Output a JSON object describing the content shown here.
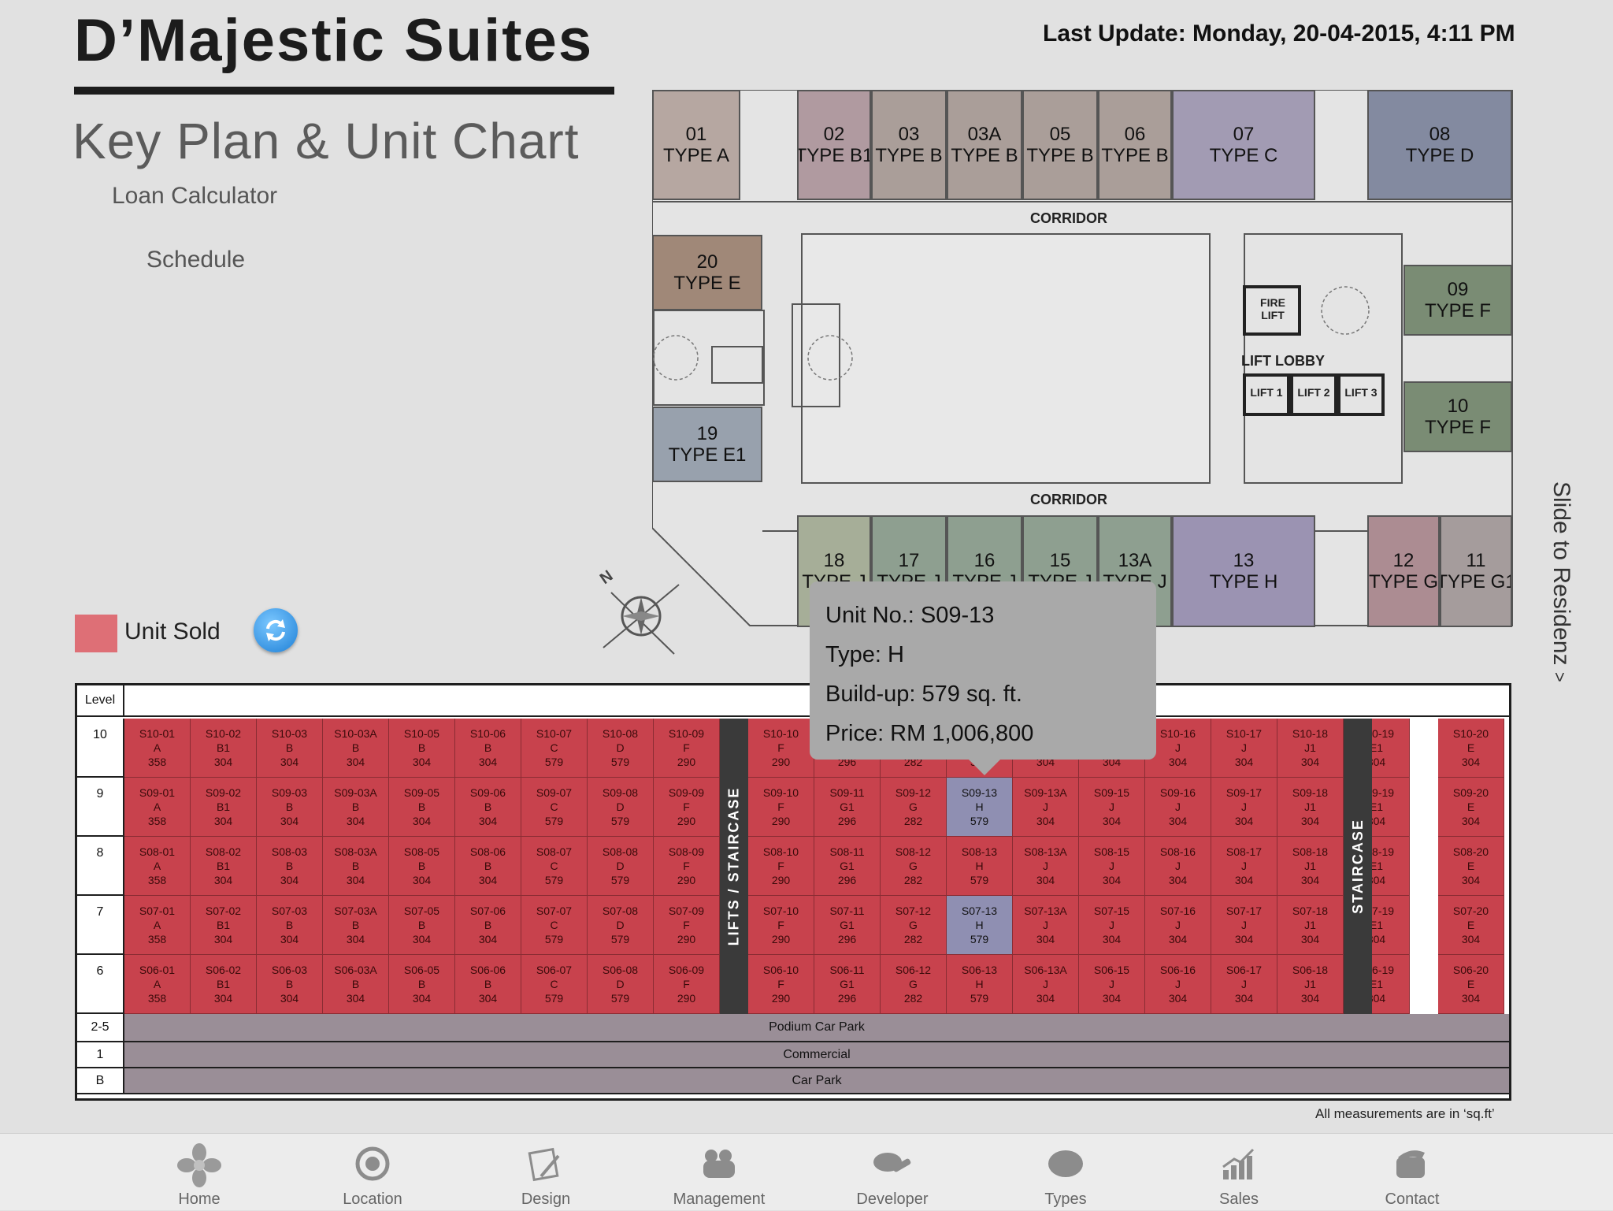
{
  "header": {
    "title": "D’Majestic Suites",
    "subtitle": "Key Plan & Unit Chart",
    "last_update": "Last Update: Monday, 20-04-2015, 4:11 PM"
  },
  "side_menu": {
    "loan_calculator": "Loan Calculator",
    "schedule": "Schedule"
  },
  "legend": {
    "sold_label": "Unit Sold",
    "sold_color": "#de6f76",
    "refresh_icon": "refresh-icon"
  },
  "slide_link": "Slide to Residenz",
  "slide_arrow": ">",
  "compass_label": "N",
  "floor_plan": {
    "corridor_top": "CORRIDOR",
    "corridor_bottom": "CORRIDOR",
    "lift_lobby": "LIFT LOBBY",
    "fire_lift": "FIRE LIFT",
    "lifts": [
      "LIFT 1",
      "LIFT 2",
      "LIFT 3"
    ],
    "units": [
      {
        "no": "01",
        "type": "TYPE A",
        "color": "#b6a7a1"
      },
      {
        "no": "02",
        "type": "TYPE B1",
        "color": "#b09aa0"
      },
      {
        "no": "03",
        "type": "TYPE B",
        "color": "#aa9e99"
      },
      {
        "no": "03A",
        "type": "TYPE B",
        "color": "#aa9e99"
      },
      {
        "no": "05",
        "type": "TYPE B",
        "color": "#aa9e99"
      },
      {
        "no": "06",
        "type": "TYPE B",
        "color": "#aa9e99"
      },
      {
        "no": "07",
        "type": "TYPE C",
        "color": "#a29bb3"
      },
      {
        "no": "08",
        "type": "TYPE D",
        "color": "#838aa0"
      },
      {
        "no": "09",
        "type": "TYPE F",
        "color": "#7a8c74"
      },
      {
        "no": "10",
        "type": "TYPE F",
        "color": "#7a8c74"
      },
      {
        "no": "20",
        "type": "TYPE E",
        "color": "#a08878"
      },
      {
        "no": "19",
        "type": "TYPE E1",
        "color": "#98a1ad"
      },
      {
        "no": "18",
        "type": "TYPE J",
        "color": "#a6ae98"
      },
      {
        "no": "17",
        "type": "TYPE J",
        "color": "#8e9f90"
      },
      {
        "no": "16",
        "type": "TYPE J",
        "color": "#8e9f90"
      },
      {
        "no": "15",
        "type": "TYPE J",
        "color": "#8e9f90"
      },
      {
        "no": "13A",
        "type": "TYPE J",
        "color": "#8e9f90"
      },
      {
        "no": "13",
        "type": "TYPE H",
        "color": "#9b93b2"
      },
      {
        "no": "12",
        "type": "TYPE G",
        "color": "#ac8c92"
      },
      {
        "no": "11",
        "type": "TYPE G1",
        "color": "#a59c9c"
      }
    ]
  },
  "tooltip": {
    "unit_no": "Unit No.: S09-13",
    "type": "Type: H",
    "build_up": "Build-up: 579 sq. ft.",
    "price": "Price: RM 1,006,800"
  },
  "unit_chart": {
    "level_header": "Level",
    "staircase_left": "LIFTS / STAIRCASE",
    "staircase_right": "STAIRCASE",
    "columns": [
      {
        "code": "01",
        "type": "A",
        "size": "358"
      },
      {
        "code": "02",
        "type": "B1",
        "size": "304"
      },
      {
        "code": "03",
        "type": "B",
        "size": "304"
      },
      {
        "code": "03A",
        "type": "B",
        "size": "304"
      },
      {
        "code": "05",
        "type": "B",
        "size": "304"
      },
      {
        "code": "06",
        "type": "B",
        "size": "304"
      },
      {
        "code": "07",
        "type": "C",
        "size": "579"
      },
      {
        "code": "08",
        "type": "D",
        "size": "579"
      },
      {
        "code": "09",
        "type": "F",
        "size": "290"
      },
      {
        "code": "10",
        "type": "F",
        "size": "290"
      },
      {
        "code": "11",
        "type": "G1",
        "size": "296"
      },
      {
        "code": "12",
        "type": "G",
        "size": "282"
      },
      {
        "code": "13",
        "type": "H",
        "size": "579"
      },
      {
        "code": "13A",
        "type": "J",
        "size": "304"
      },
      {
        "code": "15",
        "type": "J",
        "size": "304"
      },
      {
        "code": "16",
        "type": "J",
        "size": "304"
      },
      {
        "code": "17",
        "type": "J",
        "size": "304"
      },
      {
        "code": "18",
        "type": "J1",
        "size": "304"
      },
      {
        "code": "19",
        "type": "E1",
        "size": "304"
      },
      {
        "code": "20",
        "type": "E",
        "size": "304"
      }
    ],
    "rows": [
      {
        "level": "10",
        "prefix": "S10",
        "available": []
      },
      {
        "level": "9",
        "prefix": "S09",
        "available": [
          "13"
        ]
      },
      {
        "level": "8",
        "prefix": "S08",
        "available": []
      },
      {
        "level": "7",
        "prefix": "S07",
        "available": [
          "13"
        ]
      },
      {
        "level": "6",
        "prefix": "S06",
        "available": []
      }
    ],
    "lower_levels": [
      {
        "level": "2-5",
        "label": "Podium Car Park"
      },
      {
        "level": "1",
        "label": "Commercial"
      },
      {
        "level": "B",
        "label": "Car Park"
      }
    ],
    "note": "All measurements are in ‘sq.ft’"
  },
  "nav": [
    {
      "label": "Home",
      "icon": "home-flower-icon"
    },
    {
      "label": "Location",
      "icon": "location-target-icon"
    },
    {
      "label": "Design",
      "icon": "design-pencil-icon"
    },
    {
      "label": "Management",
      "icon": "management-people-icon"
    },
    {
      "label": "Developer",
      "icon": "developer-handshake-icon"
    },
    {
      "label": "Types",
      "icon": "types-oval-icon"
    },
    {
      "label": "Sales",
      "icon": "sales-chart-icon"
    },
    {
      "label": "Contact",
      "icon": "contact-phone-icon"
    }
  ]
}
